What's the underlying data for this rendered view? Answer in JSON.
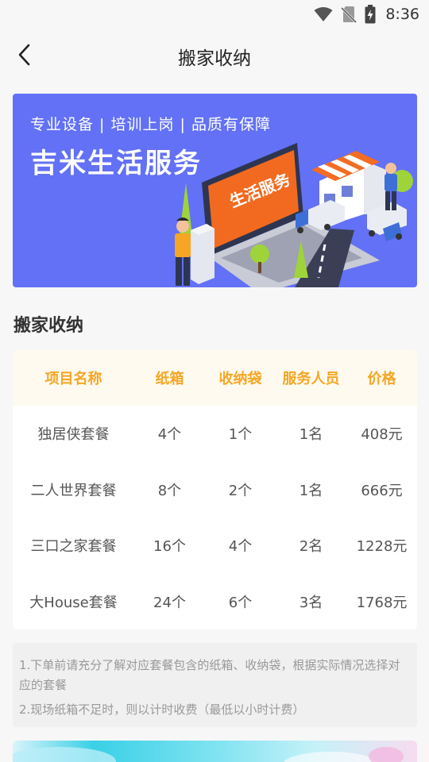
{
  "status_bar": {
    "time": "8:36"
  },
  "nav": {
    "title": "搬家收纳"
  },
  "banner": {
    "tagline": "专业设备 | 培训上岗 | 品质有保障",
    "brand": "吉米生活服务",
    "screen_label": "生活服务",
    "colors": {
      "background": "#6271f5",
      "screen": "#f26a1f",
      "awning": "#f36c24"
    }
  },
  "section": {
    "title": "搬家收纳"
  },
  "table": {
    "headers": [
      "项目名称",
      "纸箱",
      "收纳袋",
      "服务人员",
      "价格"
    ],
    "rows": [
      [
        "独居侠套餐",
        "4个",
        "1个",
        "1名",
        "408元"
      ],
      [
        "二人世界套餐",
        "8个",
        "2个",
        "1名",
        "666元"
      ],
      [
        "三口之家套餐",
        "16个",
        "4个",
        "2名",
        "1228元"
      ],
      [
        "大House套餐",
        "24个",
        "6个",
        "3名",
        "1768元"
      ]
    ],
    "header_color": "#f5a623"
  },
  "notes": [
    "1.下单前请充分了解对应套餐包含的纸箱、收纳袋，根据实际情况选择对应的套餐",
    "2.现场纸箱不足时，则以计时收费（最低以小时计费）"
  ],
  "icons": [
    "wifi-icon",
    "no-sim-icon",
    "battery-charging-icon",
    "back-arrow-icon"
  ]
}
